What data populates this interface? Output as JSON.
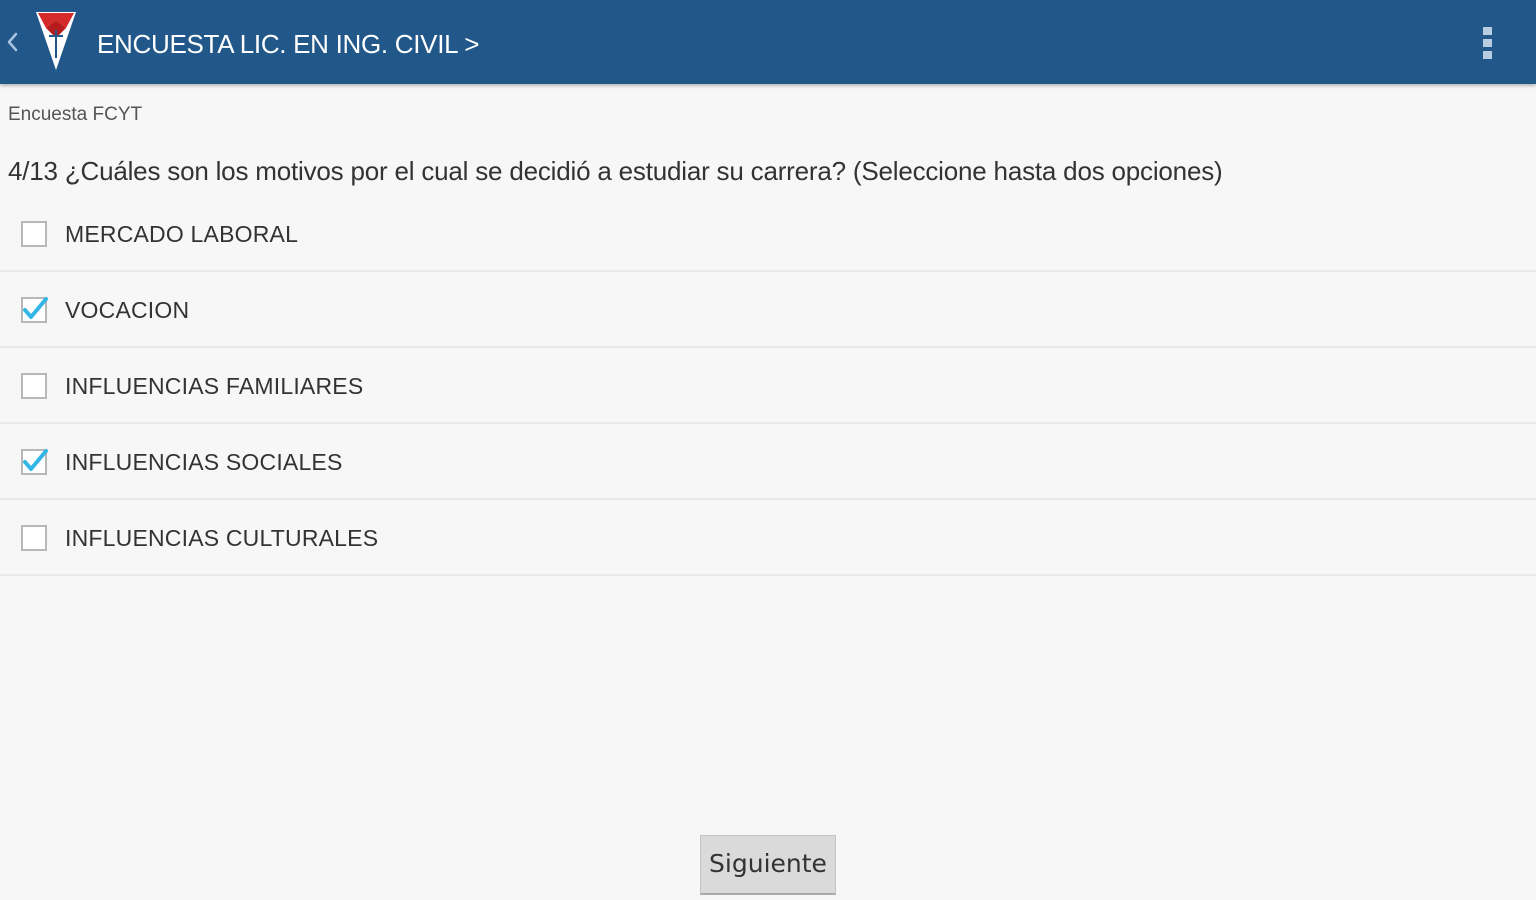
{
  "app_bar": {
    "title": "ENCUESTA LIC. EN ING. CIVIL >",
    "background_color": "#22578a",
    "back_icon": "chevron-left-icon",
    "logo_icon": "university-shield-logo",
    "menu_icon": "overflow-menu-icon"
  },
  "survey": {
    "subtitle": "Encuesta FCYT",
    "question": "4/13 ¿Cuáles son los motivos por el cual se decidió a estudiar su carrera? (Seleccione hasta dos opciones)",
    "options": [
      {
        "label": "MERCADO LABORAL",
        "checked": false
      },
      {
        "label": "VOCACION",
        "checked": true
      },
      {
        "label": "INFLUENCIAS FAMILIARES",
        "checked": false
      },
      {
        "label": "INFLUENCIAS SOCIALES",
        "checked": true
      },
      {
        "label": "INFLUENCIAS CULTURALES",
        "checked": false
      }
    ],
    "check_color": "#33b5e5"
  },
  "footer": {
    "next_label": "Siguiente"
  }
}
